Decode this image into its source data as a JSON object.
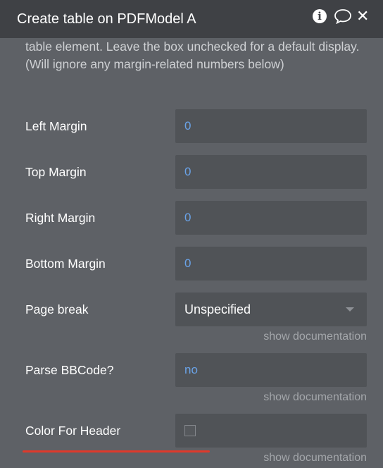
{
  "header": {
    "title": "Create table on PDFModel A"
  },
  "description": "table element. Leave the box unchecked for a default display. (Will ignore any margin-related numbers below)",
  "fields": {
    "left_margin": {
      "label": "Left Margin",
      "value": "0"
    },
    "top_margin": {
      "label": "Top Margin",
      "value": "0"
    },
    "right_margin": {
      "label": "Right Margin",
      "value": "0"
    },
    "bottom_margin": {
      "label": "Bottom Margin",
      "value": "0"
    },
    "page_break": {
      "label": "Page break",
      "value": "Unspecified",
      "docs": "show documentation"
    },
    "parse_bbcode": {
      "label": "Parse BBCode?",
      "value": "no",
      "docs": "show documentation"
    },
    "color_for_header": {
      "label": "Color For Header",
      "checked": false,
      "docs": "show documentation"
    }
  },
  "colors": {
    "panel_bg": "#5e6166",
    "header_bg": "#3f4145",
    "field_bg": "#505357",
    "value_blue": "#6aa3e8",
    "annotation_red": "#e0392b"
  },
  "icons": [
    "info-icon",
    "comment-icon",
    "close-icon",
    "chevron-down-icon",
    "checkbox"
  ]
}
